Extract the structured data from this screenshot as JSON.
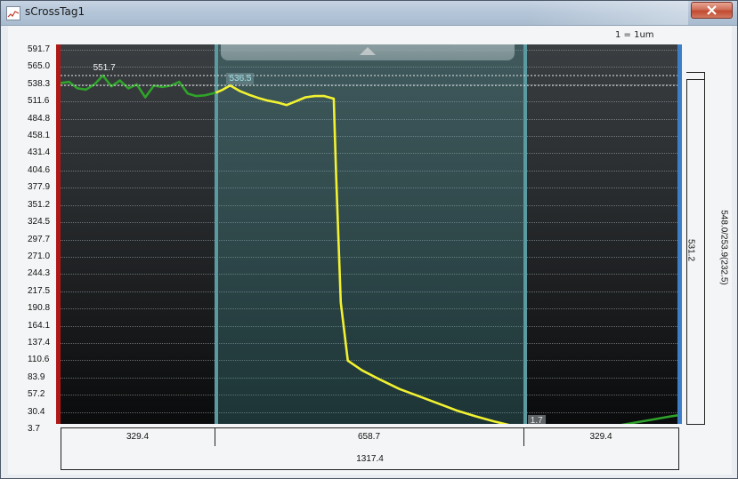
{
  "window": {
    "title": "sCrossTag1",
    "icon": "chart-app-icon",
    "close_icon": "close-icon"
  },
  "scale_label": "1 = 1um",
  "y_ticks": [
    "591.7",
    "565.0",
    "538.3",
    "511.6",
    "484.8",
    "458.1",
    "431.4",
    "404.6",
    "377.9",
    "351.2",
    "324.5",
    "297.7",
    "271.0",
    "244.3",
    "217.5",
    "190.8",
    "164.1",
    "137.4",
    "110.6",
    "83.9",
    "57.2",
    "30.4",
    "3.7"
  ],
  "markers": {
    "max_left": "551.7",
    "max_mid": "536.5",
    "min_right": "1.7"
  },
  "bottom": {
    "seg_left": "329.4",
    "seg_mid": "658.7",
    "seg_right": "329.4",
    "total": "1317.4"
  },
  "right_labels": {
    "inner": "531.2",
    "outer": "548.0/253.9(232.5)"
  },
  "colors": {
    "left_bar": "#b01818",
    "right_bar": "#3d7ec9",
    "green_series": "#2fa32a",
    "yellow_series": "#f2f231",
    "zone": "#5b9aa1"
  },
  "chart_data": {
    "type": "line",
    "ylim": [
      3.7,
      591.7
    ],
    "xlim": [
      0,
      1317.4
    ],
    "regions": [
      {
        "from": 0,
        "to": 329.4
      },
      {
        "from": 329.4,
        "to": 988.1
      },
      {
        "from": 988.1,
        "to": 1317.4
      }
    ],
    "series": [
      {
        "color": "#2fa32a",
        "x": [
          0,
          18,
          36,
          54,
          72,
          90,
          108,
          126,
          144,
          162,
          180,
          198,
          216,
          234,
          252,
          270,
          288,
          306,
          329.4
        ],
        "y": [
          540,
          542,
          532,
          530,
          538,
          551.7,
          535,
          544,
          532,
          538,
          518,
          536,
          534,
          536,
          542,
          524,
          520,
          521,
          525
        ]
      },
      {
        "color": "#f2f231",
        "x": [
          329.4,
          345,
          360,
          380,
          400,
          420,
          440,
          460,
          480,
          500,
          520,
          540,
          560,
          580,
          585,
          595,
          610,
          640,
          680,
          720,
          760,
          800,
          840,
          880,
          920,
          960,
          988.1
        ],
        "y": [
          525,
          530,
          536.5,
          528,
          522,
          517,
          513,
          510,
          506,
          512,
          518,
          520,
          520,
          516,
          400,
          200,
          110,
          95,
          80,
          66,
          55,
          44,
          33,
          24,
          16,
          9,
          5
        ]
      },
      {
        "color": "#2fa32a",
        "x": [
          988.1,
          1020,
          1060,
          1100,
          1140,
          1180,
          1220,
          1260,
          1290,
          1317.4
        ],
        "y": [
          5,
          4,
          3.7,
          4,
          6,
          9,
          14,
          19,
          23,
          26
        ]
      }
    ]
  }
}
